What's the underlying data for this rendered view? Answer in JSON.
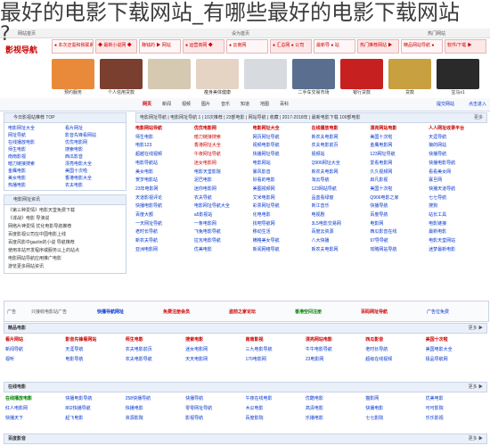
{
  "overlay": {
    "line1": "最好的电影下载网站_有哪些最好的电影下载网站",
    "line2": "?"
  },
  "topbar": {
    "left": "网站首页",
    "mid": "设为首页",
    "right": "热门网站"
  },
  "logo": "影视导航",
  "banners": [
    "● 本次还需和我联系",
    "◆ 最新小说网 ◆",
    "赚钱的 ▶ 网站",
    "● 运营商网 ◆",
    "● 云南网",
    "● 汇总网 ● 公司",
    "最新导 ● 站",
    "热门推荐网站 ▶",
    "精品网站导航 ●",
    "软件/下载 ▶"
  ],
  "thumbs": [
    {
      "label": "预约服务",
      "color": "#e88a3a"
    },
    {
      "label": "个人信用贷款",
      "color": "#7a3f2f"
    },
    {
      "label": "",
      "color": "#d6c9b2"
    },
    {
      "label": "瘦身美体健康",
      "color": "#e5d3c4"
    },
    {
      "label": "",
      "color": "#d7dbe0"
    },
    {
      "label": "二手车交易市场",
      "color": "#5a6f8f"
    },
    {
      "label": "银行贷款",
      "color": "#c62020"
    },
    {
      "label": "贷款",
      "color": "#c9a040"
    },
    {
      "label": "宝马x1",
      "color": "#2a2a2a"
    }
  ],
  "searchbar": {
    "tabs": [
      "网页",
      "新闻",
      "视频",
      "图片",
      "音乐",
      "知道",
      "地图",
      "百科"
    ],
    "active": 0,
    "submit": "提交网站",
    "home": "点击进入"
  },
  "left": {
    "sites_title": "今日影视站推荐 TOP",
    "sites": [
      "电影网址大全",
      "看片网址",
      "网址导航",
      "影音先锋看网站",
      "在线播放电影",
      "优优电影网",
      "师生电影",
      "搜索电影",
      "南南影视",
      "西瓜影音",
      "暗刀链接搜索",
      "漂亮电影大全",
      "金鹰电影",
      "美国十次啦",
      "美女电影",
      "香港电影大全",
      "热播电影",
      "农夫电影"
    ],
    "news_title": "电影网址资讯",
    "news": [
      "《第三种爱情》电影天堂免费下载",
      "《谍战》电影 导演说",
      "网络片神爱情 优化电影导航推荐",
      "百度影视公司在中国电影上线",
      "百度风影中gaolin的小说 导航推荐",
      "使用本站开发程序或服务以上的站点",
      "电影网站导航应用推广电影",
      "游览更多网站资讯"
    ]
  },
  "main": {
    "head": "电影网址导航 | 电影网址导航 1 | 10次推荐 | 23部电影 | 网站导航 | 收藏 | 2017-2018年 | 最新电影下载 100部电影",
    "more": "更多",
    "links": [
      "电影网站导航",
      "优优电影网",
      "电影网址大全",
      "在线播放电影",
      "漂亮网站电影",
      "人人网址收录平台",
      "师生电影",
      "暗刀链接搜索",
      "网页网址导航",
      "新农夫电影网",
      "美国十次啦",
      "天涯导航",
      "电影123",
      "香港网址大全",
      "视频电影导航",
      "农夫电影前页",
      "金鹰电影网",
      "狼的网站",
      "超越在线视频",
      "午夜网址导航",
      "快播网址导航",
      "视频站",
      "123网址导航",
      "快播导航",
      "电影导航站",
      "迷女电影网",
      "电影网站",
      "Q906网址大全",
      "爱看电影网",
      "快播电影导航",
      "美女电影",
      "电影天堂影院",
      "暴风影音",
      "新农夫电影网",
      "久久视频网",
      "看看美女网",
      "贺岁电影站",
      "泥巴电影",
      "好看的电影",
      "淘云导航",
      "启凡影视",
      "寡旦网",
      "23年电影网",
      "迷你电影网",
      "美图视频网",
      "123网站导航",
      "美国十次啦",
      "快播天道导航",
      "天道影视评论",
      "农夫导航",
      "艾米电影网",
      "品蓝看绿窗",
      "Q906电影之家",
      "七七导航",
      "快播电影导航",
      "电影网址导航大全",
      "彩票网址导航",
      "新江音乐",
      "快播导航",
      "搜狗",
      "百度大额",
      "a5影视站",
      "化电电影",
      "电视剧",
      "百度导航",
      "站长工具",
      "一天网址导航",
      "一条电影网",
      "找吧导航网",
      "3L5电影交易网",
      "电影网",
      "电影链接",
      "老时长导航",
      "飞兔电影导航",
      "移动生活",
      "百度云资源",
      "西瓜影音在线",
      "最新电影",
      "新农夫导航",
      "拉瓦电影导航",
      "横格美女导航",
      "八大快播",
      "97导导航",
      "电影天堂网站",
      "亚洲电影网",
      "优美电影",
      "新闻网络导航",
      "新农夫电影网",
      "攻略网站导航",
      "迷梦最新电影"
    ]
  },
  "ad": {
    "label": "广告",
    "items": [
      "只接收电影站广告",
      "快播导航网址",
      "免费注册会员",
      "盗前之家论坛",
      "香港空间注册",
      "百码网址导航",
      "广告位免费"
    ]
  },
  "sections": [
    {
      "title": "精品电影",
      "more": "更多 ▶",
      "links": [
        "看片网站",
        "影音先锋看网站",
        "师生电影",
        "搜索电影",
        "南南影视",
        "漂亮网站电影",
        "西瓜影音",
        "美国十次啦",
        "新闻导航",
        "天涯导航",
        "农夫电影前页",
        "迷女电影网",
        "三九电影导航",
        "牛牛电影导航",
        "老时长导航",
        "美国电影大全",
        "视听",
        "电影导航",
        "农夫电影导航",
        "天天电影网",
        "170电影网",
        "23电影网",
        "超级在线视频",
        "极品导航网"
      ]
    },
    {
      "title": "在线电影",
      "more": "更多 ▶",
      "links": [
        "在线播放电影",
        "快播电影导航",
        "258快播导航",
        "快播导航",
        "午夜在线电影",
        "优酷电影",
        "猫影网",
        "优美电影",
        "红人电影网",
        "802快播导航",
        "快播电影",
        "零零网址导航",
        "木瓜电影",
        "高清电影",
        "快播电影",
        "可可影院",
        "快播天下",
        "起飞电影",
        "资源影院",
        "影视导航",
        "百度影院",
        "乐播电影",
        "七七影院",
        "乐乐影视"
      ]
    },
    {
      "title": "百度影音",
      "more": "更多 ▶",
      "links": []
    }
  ]
}
